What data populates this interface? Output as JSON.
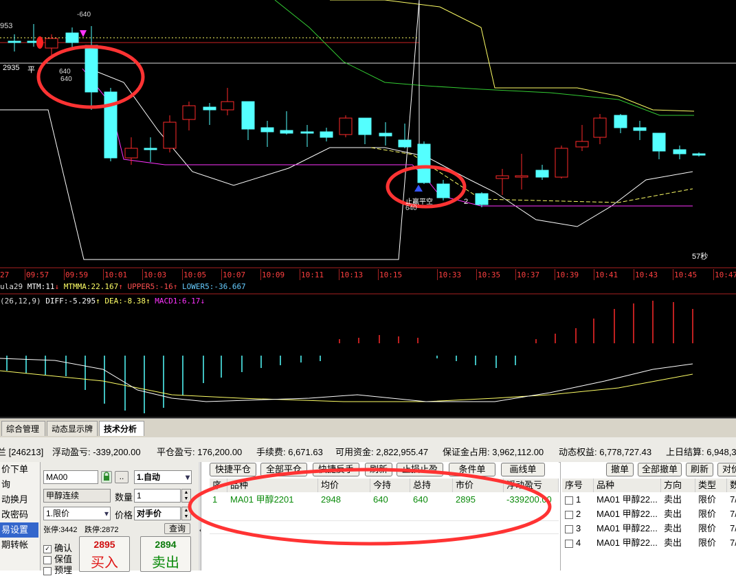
{
  "chart": {
    "top_left_price": "953",
    "price_marker": "2935",
    "ping_label": "平",
    "label_640_top": "-640",
    "label_640_a": "640",
    "label_640_b": "640",
    "label_640_c": "640",
    "stop_label": "止赢平空",
    "countdown": "57秒",
    "mark_2": "2",
    "time_labels": [
      "27",
      "09:57",
      "09:59",
      "10:01",
      "10:03",
      "10:05",
      "10:07",
      "10:09",
      "10:11",
      "10:13",
      "10:15",
      "10:33",
      "10:35",
      "10:37",
      "10:39",
      "10:41",
      "10:43",
      "10:45",
      "10:47"
    ],
    "indicator1": {
      "name": "ula29",
      "mtm": "MTM:11",
      "mtmma": "MTMMA:22.167",
      "upper": "UPPER5:-16",
      "lower": "LOWER5:-36.667"
    },
    "indicator2": {
      "params": "(26,12,9)",
      "diff": "DIFF:-5.295",
      "dea": "DEA:-8.38",
      "macd": "MACD1:6.17"
    },
    "colors": {
      "up": "#ff2a2a",
      "down": "#54ffff",
      "ma_white": "#ffffff",
      "ma_yellow": "#ffff66",
      "ma_green": "#33cc33",
      "ma_magenta": "#ff33ff",
      "annotation": "#ff3333"
    }
  },
  "tabs": [
    "综合管理",
    "动态显示牌",
    "技术分析"
  ],
  "summary": {
    "account": "兰 [246213]",
    "float_pl": "浮动盈亏: -339,200.00",
    "close_pl": "平仓盈亏: 176,200.00",
    "fee": "手续费: 6,671.63",
    "available": "可用资金: 2,822,955.47",
    "margin": "保证金占用: 3,962,112.00",
    "equity": "动态权益: 6,778,727.43",
    "settle": "上日结算: 6,948,3"
  },
  "nav": [
    "价下单",
    "询",
    "动换月",
    "改密码",
    "易设置",
    "期转帐"
  ],
  "order": {
    "contract": "MA00",
    "mode": "1.自动",
    "name": "甲醇连续",
    "qty_label": "数量",
    "qty": "1",
    "price_type": "1.限价",
    "price_label": "价格",
    "price": "对手价",
    "limit_up": "张停:3442",
    "limit_down": "跌停:2872",
    "query": "查询",
    "confirm": "确认",
    "hedge": "保值",
    "arb": "预埋",
    "buy_price": "2895",
    "buy_label": "买入",
    "sell_price": "2894",
    "sell_label": "卖出",
    "dots": ".."
  },
  "positions": {
    "buttons": [
      "快捷平仓",
      "全部平仓",
      "快捷反手",
      "刷新",
      "止损止盈",
      "条件单",
      "画线单"
    ],
    "headers": [
      "序",
      "品种",
      "均价",
      "今持",
      "总持",
      "市价",
      "浮动盈亏"
    ],
    "rows": [
      {
        "no": "1",
        "name": "MA01 甲醇2201",
        "avg": "2948",
        "today": "640",
        "total": "640",
        "price": "2895",
        "pl": "-339200.00"
      }
    ]
  },
  "orders": {
    "buttons": [
      "撤单",
      "全部撤单",
      "刷新",
      "对价"
    ],
    "headers": [
      "序号",
      "品种",
      "方向",
      "类型",
      "数"
    ],
    "rows": [
      {
        "no": "1",
        "name": "MA01 甲醇22...",
        "dir": "卖出",
        "type": "限价",
        "n": "7/"
      },
      {
        "no": "2",
        "name": "MA01 甲醇22...",
        "dir": "卖出",
        "type": "限价",
        "n": "7/"
      },
      {
        "no": "3",
        "name": "MA01 甲醇22...",
        "dir": "卖出",
        "type": "限价",
        "n": "7/"
      },
      {
        "no": "4",
        "name": "MA01 甲醇22...",
        "dir": "卖出",
        "type": "限价",
        "n": "7/"
      }
    ]
  }
}
